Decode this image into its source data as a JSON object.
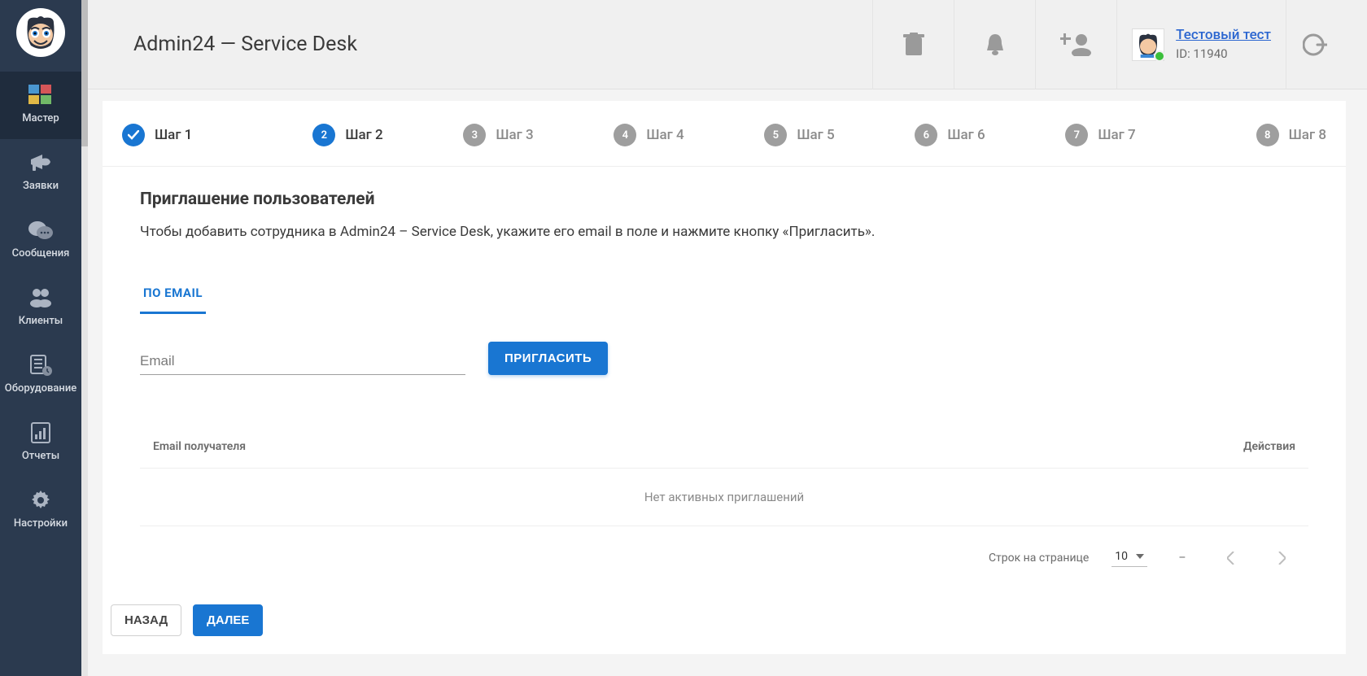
{
  "sidebar": {
    "items": [
      {
        "label": "Мастер"
      },
      {
        "label": "Заявки"
      },
      {
        "label": "Сообщения"
      },
      {
        "label": "Клиенты"
      },
      {
        "label": "Оборудование"
      },
      {
        "label": "Отчеты"
      },
      {
        "label": "Настройки"
      }
    ]
  },
  "header": {
    "title": "Admin24 — Service Desk",
    "user_name": "Тестовый тест",
    "user_id": "ID: 11940"
  },
  "stepper": [
    {
      "num": "1",
      "label": "Шаг 1",
      "state": "done"
    },
    {
      "num": "2",
      "label": "Шаг 2",
      "state": "active"
    },
    {
      "num": "3",
      "label": "Шаг 3",
      "state": "future"
    },
    {
      "num": "4",
      "label": "Шаг 4",
      "state": "future"
    },
    {
      "num": "5",
      "label": "Шаг 5",
      "state": "future"
    },
    {
      "num": "6",
      "label": "Шаг 6",
      "state": "future"
    },
    {
      "num": "7",
      "label": "Шаг 7",
      "state": "future"
    },
    {
      "num": "8",
      "label": "Шаг 8",
      "state": "future"
    }
  ],
  "panel": {
    "title": "Приглашение пользователей",
    "desc": "Чтобы добавить сотрудника в Admin24 – Service Desk, укажите его email в поле и нажмите кнопку «Пригласить».",
    "tab_label": "ПО EMAIL",
    "email_placeholder": "Email",
    "invite_btn": "ПРИГЛАСИТЬ"
  },
  "table": {
    "col_email": "Email получателя",
    "col_actions": "Действия",
    "empty": "Нет активных приглашений",
    "rows_label": "Строк на странице",
    "rows_value": "10",
    "range": "–"
  },
  "nav": {
    "back": "НАЗАД",
    "next": "ДАЛЕЕ"
  }
}
